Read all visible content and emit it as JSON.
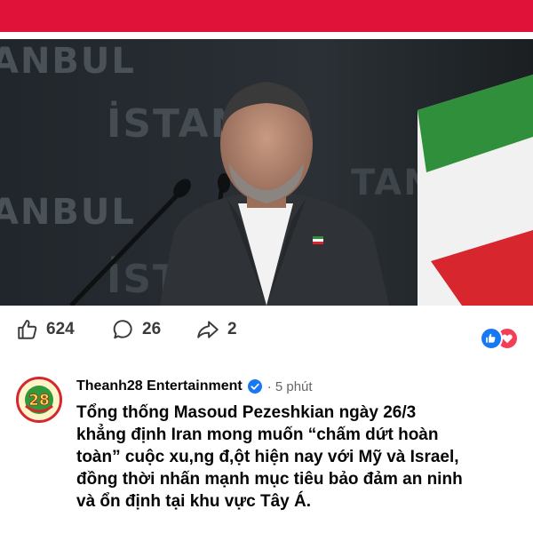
{
  "colors": {
    "banner": "#e0123a",
    "like_blue": "#1877f2",
    "love_red": "#f33e58",
    "verified_blue": "#1877f2",
    "meta_gray": "#65676b"
  },
  "photo": {
    "backdrop_words": [
      "ANBUL",
      "İSTAN",
      "ANBUL",
      "İSTA",
      "TAN"
    ],
    "icons": {
      "flag": "iran-flag",
      "pin": "lapel-pin-icon"
    }
  },
  "actions": {
    "like": {
      "icon": "like-icon",
      "count": "624"
    },
    "comment": {
      "icon": "comment-icon",
      "count": "26"
    },
    "share": {
      "icon": "share-icon",
      "count": "2"
    },
    "reactions": [
      "like-reaction-icon",
      "love-reaction-icon"
    ]
  },
  "post": {
    "avatar_text": "28",
    "page_name": "Theanh28 Entertainment",
    "time": "· 5 phút",
    "lines": [
      "Tổng thống Masoud Pezeshkian ngày 26/3",
      "khẳng định Iran mong muốn “chấm dứt hoàn",
      "toàn” cuộc xu,ng đ,ột hiện nay với Mỹ và Israel,",
      "đồng thời nhấn mạnh mục tiêu bảo đảm an ninh",
      "và ổn định tại khu vực Tây Á."
    ]
  }
}
